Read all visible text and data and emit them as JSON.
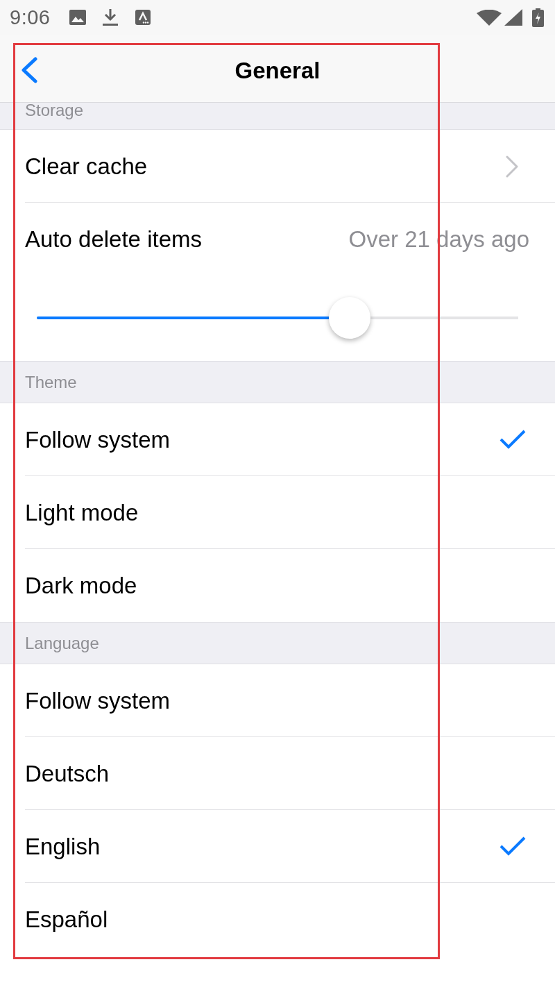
{
  "status_bar": {
    "time": "9:06"
  },
  "nav_bar": {
    "title": "General"
  },
  "sections": [
    {
      "header": "Storage",
      "rows": [
        {
          "kind": "link",
          "label": "Clear cache"
        },
        {
          "kind": "slider",
          "label": "Auto delete items",
          "value": "Over 21 days ago",
          "level": 0.65
        }
      ]
    },
    {
      "header": "Theme",
      "rows": [
        {
          "kind": "option",
          "label": "Follow system",
          "selected": true
        },
        {
          "kind": "option",
          "label": "Light mode",
          "selected": false
        },
        {
          "kind": "option",
          "label": "Dark mode",
          "selected": false
        }
      ]
    },
    {
      "header": "Language",
      "rows": [
        {
          "kind": "option",
          "label": "Follow system",
          "selected": false
        },
        {
          "kind": "option",
          "label": "Deutsch",
          "selected": false
        },
        {
          "kind": "option",
          "label": "English",
          "selected": true
        },
        {
          "kind": "option",
          "label": "Español",
          "selected": false
        }
      ]
    }
  ]
}
